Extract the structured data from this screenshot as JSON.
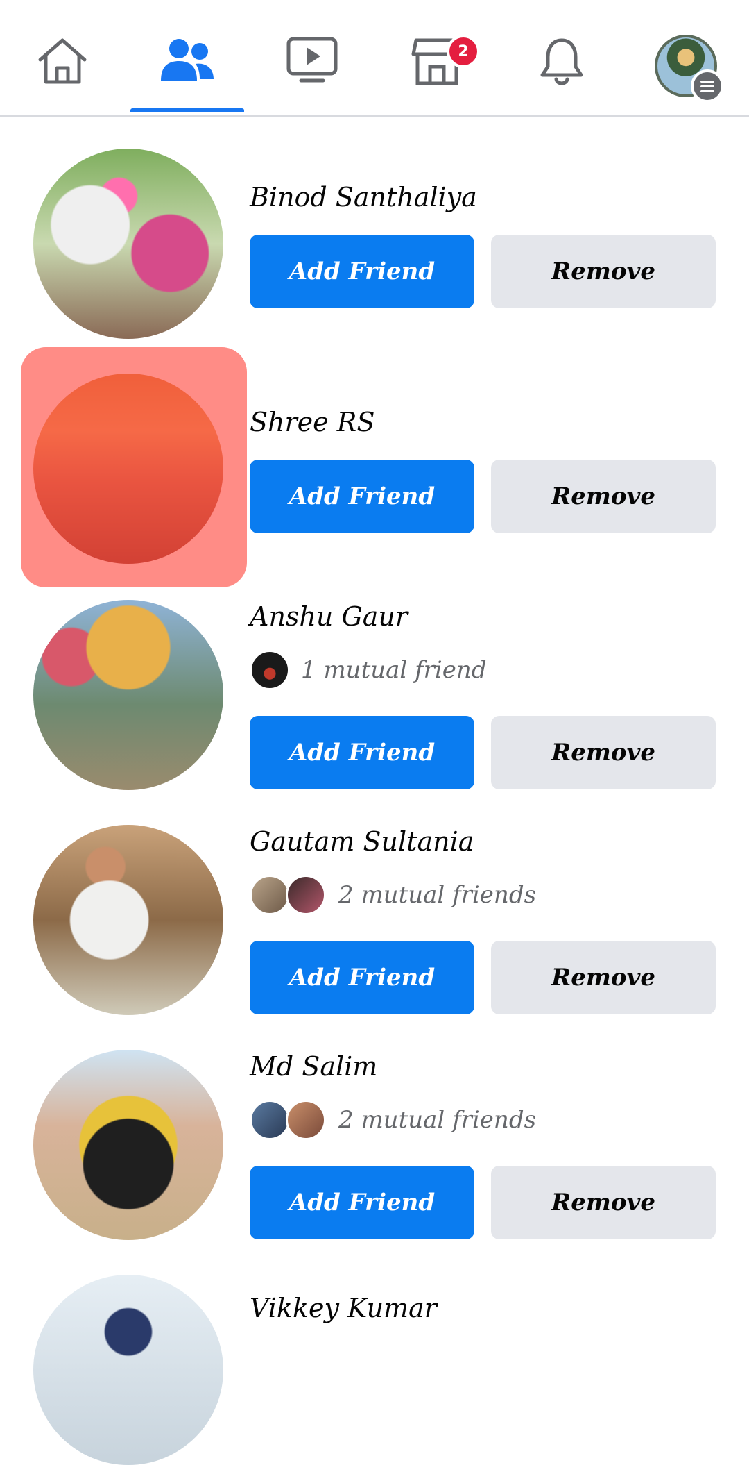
{
  "nav": {
    "tabs": [
      {
        "name": "home",
        "icon": "home-icon"
      },
      {
        "name": "friends",
        "icon": "friends-icon",
        "active": true
      },
      {
        "name": "watch",
        "icon": "video-icon"
      },
      {
        "name": "marketplace",
        "icon": "marketplace-icon",
        "badge": "2"
      },
      {
        "name": "notifications",
        "icon": "bell-icon"
      },
      {
        "name": "profile-menu",
        "icon": "menu-icon"
      }
    ],
    "accent_color": "#1877f2",
    "badge_color": "#e41e3f"
  },
  "suggestions": [
    {
      "name": "Binod Santhaliya",
      "mutual": "",
      "add_label": "Add Friend",
      "remove_label": "Remove"
    },
    {
      "name": "Shree RS",
      "mutual": "",
      "add_label": "Add Friend",
      "remove_label": "Remove",
      "highlighted": true
    },
    {
      "name": "Anshu Gaur",
      "mutual": "1 mutual friend",
      "add_label": "Add Friend",
      "remove_label": "Remove"
    },
    {
      "name": "Gautam Sultania",
      "mutual": "2 mutual friends",
      "add_label": "Add Friend",
      "remove_label": "Remove"
    },
    {
      "name": "Md Salim",
      "mutual": "2 mutual friends",
      "add_label": "Add Friend",
      "remove_label": "Remove"
    },
    {
      "name": "Vikkey Kumar",
      "mutual": "",
      "add_label": "",
      "remove_label": ""
    }
  ],
  "colors": {
    "add_button": "#0a7cf0",
    "remove_button": "#e4e6eb",
    "highlight": "#ff463c"
  }
}
